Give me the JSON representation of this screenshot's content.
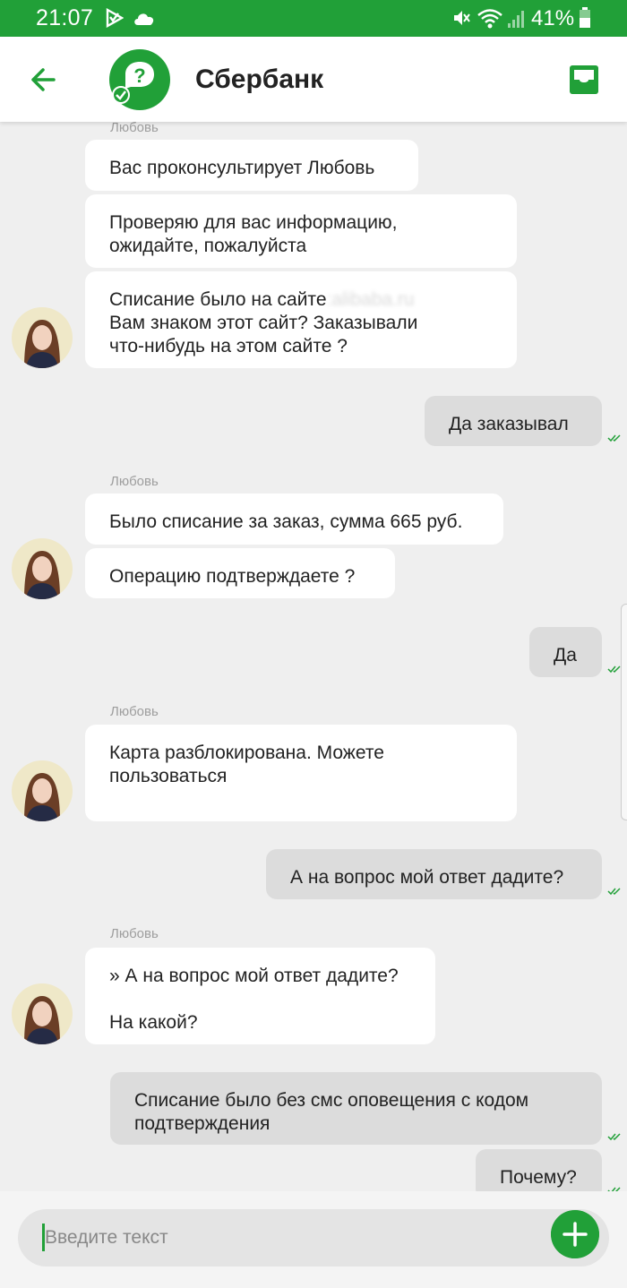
{
  "status_bar": {
    "time": "21:07",
    "battery_percent": "41%",
    "icons": [
      "play-check-icon",
      "cloud-icon",
      "mute-icon",
      "wifi-icon",
      "signal-icon",
      "battery-icon"
    ]
  },
  "header": {
    "title": "Сбербанк",
    "back_icon": "arrow-left-icon",
    "avatar_icon": "question-bubble-icon",
    "inbox_icon": "inbox-icon"
  },
  "colors": {
    "brand_green": "#21a038",
    "incoming_bubble": "#ffffff",
    "outgoing_bubble": "#dcdcdc",
    "chat_background": "#efefef"
  },
  "messages": {
    "sender_name": "Любовь",
    "g1": {
      "m1": "Вас проконсультирует Любовь",
      "m2_l1": "Проверяю для вас информацию,",
      "m2_l2": "ожидайте, пожалуйста",
      "m3_l1": "Списание было на сайте",
      "m3_l2": "Вам знаком этот сайт? Заказывали",
      "m3_l3": "что-нибудь на этом сайте ?"
    },
    "out1": "Да заказывал",
    "g2": {
      "m1": "Было списание за заказ, сумма 665 руб.",
      "m2": "Операцию подтверждаете ?"
    },
    "out2": "Да",
    "g3": {
      "m1_l1": "Карта разблокирована. Можете",
      "m1_l2": "пользоваться"
    },
    "out3": "А на вопрос мой ответ дадите?",
    "g4": {
      "quote": "» А на вопрос мой ответ дадите?",
      "reply": "На какой?"
    },
    "out4_l1": "Списание было без смс оповещения с кодом",
    "out4_l2": "подтверждения",
    "out5": "Почему?"
  },
  "input": {
    "placeholder": "Введите текст",
    "value": ""
  }
}
